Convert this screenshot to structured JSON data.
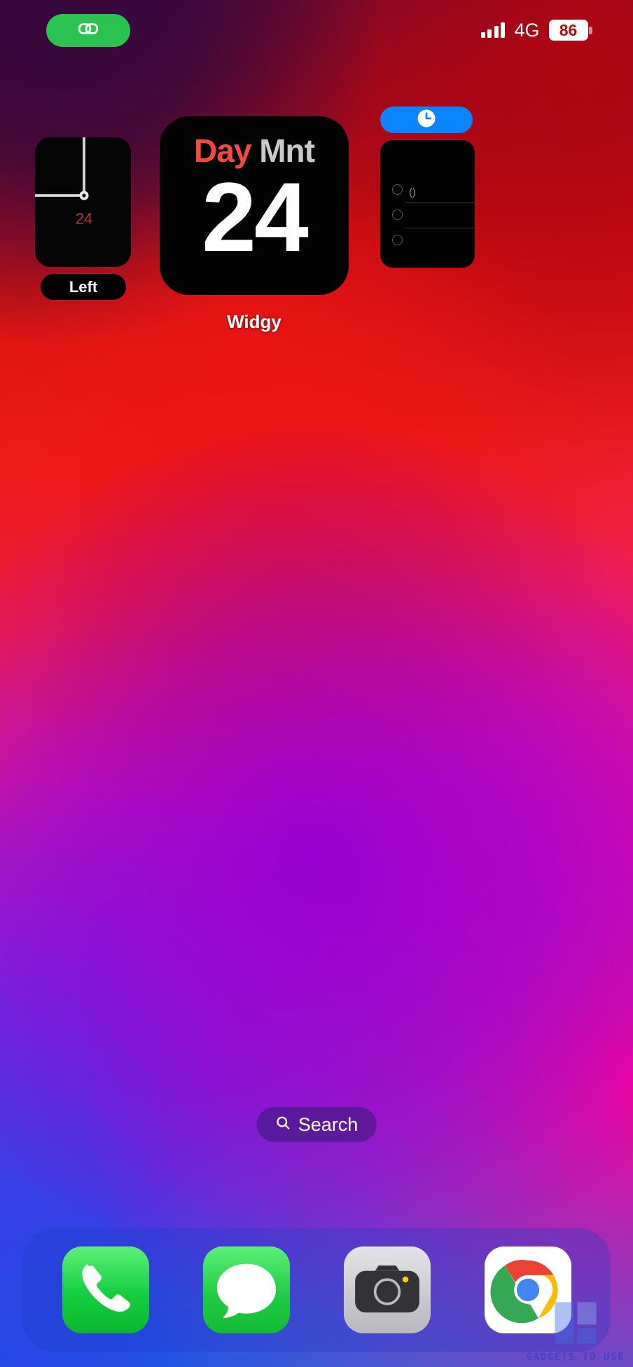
{
  "device": {
    "platform": "iOS Home Screen"
  },
  "status_bar": {
    "dynamic_island_icon": "link-pill-icon",
    "dynamic_island_color": "#2ac34f",
    "signal_icon": "cellular-bars-icon",
    "signal_bars": 4,
    "network_label": "4G",
    "battery_percent": "86",
    "battery_icon": "battery-icon"
  },
  "widgets": {
    "clock": {
      "name": "analog-clock-widget",
      "center_number": "24",
      "center_number_color": "#b3352f",
      "label": "Left"
    },
    "day": {
      "name": "day-month-widget",
      "title_day": "Day",
      "title_month": "Mnt",
      "title_day_color": "#f74a3c",
      "title_month_color": "#c9c9c9",
      "big_number": "24",
      "caption": "Widgy"
    },
    "reminders": {
      "name": "reminders-widget",
      "pill_icon": "clock-icon",
      "pill_color": "#0a84ff",
      "items": [
        {
          "text": "()"
        },
        {
          "text": ""
        },
        {
          "text": ""
        }
      ]
    }
  },
  "search": {
    "icon": "search-icon",
    "label": "Search"
  },
  "dock": {
    "apps": [
      {
        "name": "phone",
        "label": "Phone",
        "icon": "phone-icon",
        "color": "#15cf3e"
      },
      {
        "name": "messages",
        "label": "Messages",
        "icon": "message-bubble-icon",
        "color": "#20cc44"
      },
      {
        "name": "camera",
        "label": "Camera",
        "icon": "camera-icon",
        "color": "#c9c9cd"
      },
      {
        "name": "chrome",
        "label": "Chrome",
        "icon": "chrome-icon",
        "color": "#ffffff"
      }
    ]
  },
  "watermark": {
    "text": "GADGETS TO USE",
    "color": "#1a3fd0"
  },
  "wallpaper": {
    "colors": [
      "#4a0b3e",
      "#d6120f",
      "#ef1d1d",
      "#d21aa0",
      "#a318d6",
      "#4a38e8",
      "#0a7ae0"
    ]
  }
}
